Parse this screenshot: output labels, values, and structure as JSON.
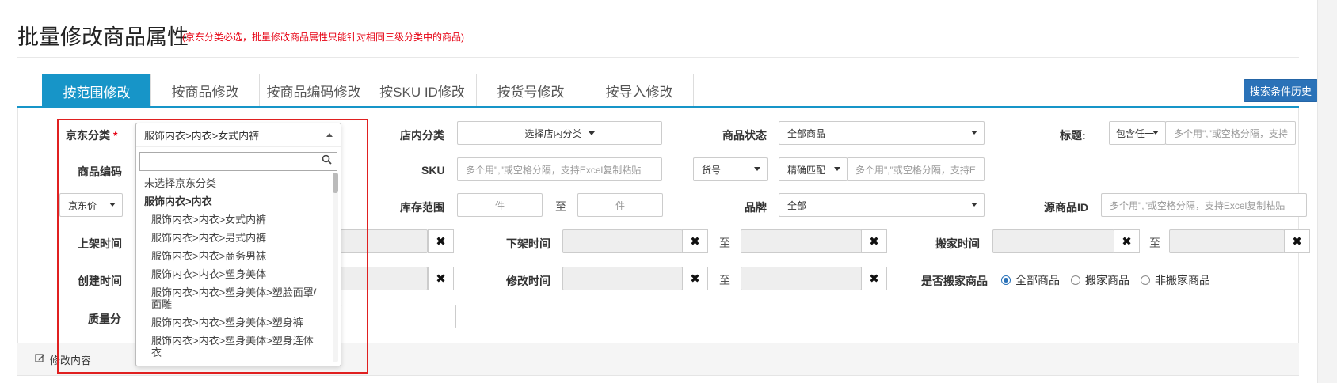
{
  "header": {
    "title": "批量修改商品属性",
    "hint": "(京东分类必选，批量修改商品属性只能针对相同三级分类中的商品)"
  },
  "tabs": [
    {
      "label": "按范围修改",
      "active": true
    },
    {
      "label": "按商品修改"
    },
    {
      "label": "按商品编码修改"
    },
    {
      "label": "按SKU ID修改"
    },
    {
      "label": "按货号修改"
    },
    {
      "label": "按导入修改"
    }
  ],
  "history_button": "搜索条件历史",
  "form": {
    "jd_category": {
      "label": "京东分类",
      "required_mark": "*",
      "value": "服饰内衣>内衣>女式内裤"
    },
    "shop_category": {
      "label": "店内分类",
      "value": "选择店内分类"
    },
    "product_status": {
      "label": "商品状态",
      "value": "全部商品"
    },
    "title": {
      "label": "标题:",
      "mode": "包含任一",
      "placeholder": "多个用\",\"或空格分隔，支持"
    },
    "product_code": {
      "label": "商品编码"
    },
    "sku": {
      "label": "SKU",
      "placeholder": "多个用\",\"或空格分隔，支持Excel复制粘贴"
    },
    "item_no": {
      "select": "货号",
      "match": "精确匹配",
      "placeholder": "多个用\",\"或空格分隔，支持E"
    },
    "jd_price": {
      "select": "京东价"
    },
    "stock_range": {
      "label": "库存范围",
      "from_placeholder": "件",
      "to_placeholder": "件",
      "sep": "至"
    },
    "brand": {
      "label": "品牌",
      "value": "全部"
    },
    "source_id": {
      "label": "源商品ID",
      "placeholder": "多个用\",\"或空格分隔，支持Excel复制粘贴"
    },
    "listed_time": {
      "label": "上架时间"
    },
    "delisted_time": {
      "label": "下架时间",
      "sep": "至"
    },
    "move_time": {
      "label": "搬家时间",
      "sep": "至"
    },
    "created_time": {
      "label": "创建时间"
    },
    "modified_time": {
      "label": "修改时间",
      "sep": "至"
    },
    "is_moved": {
      "label": "是否搬家商品",
      "options": [
        {
          "label": "全部商品",
          "checked": true
        },
        {
          "label": "搬家商品"
        },
        {
          "label": "非搬家商品"
        }
      ]
    },
    "quality": {
      "label": "质量分"
    }
  },
  "clear_glyph": "✖",
  "dropdown": {
    "items": [
      {
        "label": "未选择京东分类",
        "kind": "top"
      },
      {
        "label": "服饰内衣>内衣",
        "kind": "group"
      },
      {
        "label": "服饰内衣>内衣>女式内裤"
      },
      {
        "label": "服饰内衣>内衣>男式内裤"
      },
      {
        "label": "服饰内衣>内衣>商务男袜"
      },
      {
        "label": "服饰内衣>内衣>塑身美体"
      },
      {
        "label": "服饰内衣>内衣>塑身美体>塑脸面罩/面雕"
      },
      {
        "label": "服饰内衣>内衣>塑身美体>塑身裤"
      },
      {
        "label": "服饰内衣>内衣>塑身美体>塑身连体衣"
      }
    ]
  },
  "modify_section": {
    "label": "修改内容"
  },
  "colors": {
    "accent": "#1795c8",
    "button": "#2a72b8",
    "required": "#e60012",
    "highlight": "#e02020"
  }
}
